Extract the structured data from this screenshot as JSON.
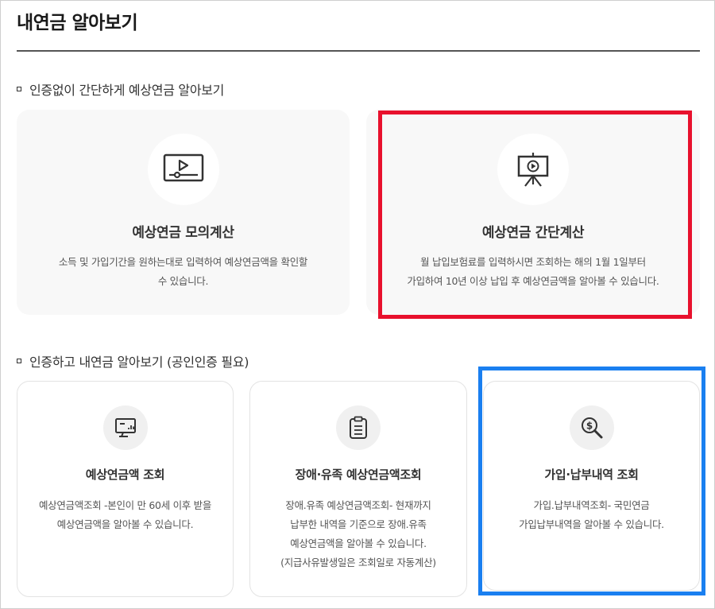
{
  "page": {
    "title": "내연금 알아보기"
  },
  "section1": {
    "heading": "인증없이 간단하게 예상연금 알아보기",
    "cards": [
      {
        "icon": "video-play-icon",
        "title": "예상연금 모의계산",
        "desc_line1": "소득 및 가입기간을 원하는대로 입력하여 예상연금액을 확인할",
        "desc_line2": "수 있습니다."
      },
      {
        "icon": "presentation-board-icon",
        "title": "예상연금 간단계산",
        "desc_line1": "월 납입보험료를 입력하시면 조회하는 해의 1월 1일부터",
        "desc_line2": "가입하여 10년 이상 납입 후 예상연금액을 알아볼 수 있습니다."
      }
    ]
  },
  "section2": {
    "heading": "인증하고 내연금 알아보기 (공인인증 필요)",
    "cards": [
      {
        "icon": "monitor-chart-icon",
        "title": "예상연금액 조회",
        "desc_line1": "예상연금액조회 -본인이 만 60세 이후 받을",
        "desc_line2": "예상연금액을 알아볼 수 있습니다."
      },
      {
        "icon": "clipboard-icon",
        "title": "장애·유족 예상연금액조회",
        "desc_line1": "장애.유족 예상연금액조회- 현재까지",
        "desc_line2": "납부한 내역을 기준으로 장애.유족",
        "desc_line3": "예상연금액을 알아볼 수 있습니다.",
        "desc_line4": "(지급사유발생일은 조회일로 자동계산)"
      },
      {
        "icon": "dollar-search-icon",
        "title": "가입·납부내역 조회",
        "desc_line1": "가입.납부내역조회- 국민연금",
        "desc_line2": "가입납부내역을 알아볼 수 있습니다."
      }
    ]
  },
  "colors": {
    "highlight_red": "#e8112d",
    "highlight_blue": "#1a7ff0"
  }
}
